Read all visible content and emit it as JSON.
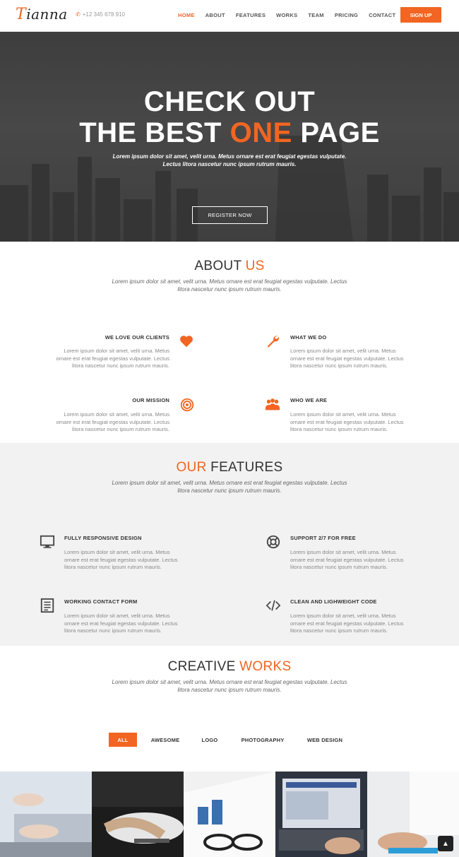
{
  "header": {
    "logo_first": "T",
    "logo_rest": "ianna",
    "phone": "+12 345 678 910",
    "nav": [
      "HOME",
      "ABOUT",
      "FEATURES",
      "WORKS",
      "TEAM",
      "PRICING",
      "CONTACT"
    ],
    "signup_label": "SIGN UP"
  },
  "hero": {
    "line1": "CHECK OUT",
    "line2_a": "THE BEST ",
    "line2_accent": "ONE",
    "line2_b": " PAGE",
    "sub1": "Lorem ipsum dolor sit amet, velit urna. Metus ornare est erat feugiat egestas vulputate.",
    "sub2": "Lectus litora nascetur nunc ipsum rutrum mauris.",
    "register_label": "REGISTER NOW"
  },
  "about": {
    "title_a": "ABOUT ",
    "title_accent": "US",
    "sub1": "Lorem ipsum dolor sit amet, velit urna. Metus ornare est erat feugiat egestas vulputate. Lectus",
    "sub2": "litora nascetur nunc ipsum rutrum mauris.",
    "items": [
      {
        "heading": "WE LOVE OUR CLIENTS",
        "l1": "Lorem ipsum dolor sit amet, velit urna. Metus",
        "l2": "ornare est erat feugiat egestas vulputate. Lectus",
        "l3": "litora nascetur nunc ipsum rutrum mauris.",
        "icon": "heart-icon"
      },
      {
        "heading": "WHAT WE DO",
        "l1": "Lorem ipsum dolor sit amet, velit urna. Metus",
        "l2": "ornare est erat feugiat egestas vulputate. Lectus",
        "l3": "litora nascetur nunc ipsum rutrum mauris.",
        "icon": "wrench-icon"
      },
      {
        "heading": "OUR MISSION",
        "l1": "Lorem ipsum dolor sit amet, velit urna. Metus",
        "l2": "ornare est erat feugiat egestas vulputate. Lectus",
        "l3": "litora nascetur nunc ipsum rutrum mauris.",
        "icon": "target-icon"
      },
      {
        "heading": "WHO WE ARE",
        "l1": "Lorem ipsum dolor sit amet, velit urna. Metus",
        "l2": "ornare est erat feugiat egestas vulputate. Lectus",
        "l3": "litora nascetur nunc ipsum rutrum mauris.",
        "icon": "users-icon"
      }
    ]
  },
  "features": {
    "title_accent": "OUR",
    "title_b": " FEATURES",
    "sub1": "Lorem ipsum dolor sit amet, velit urna. Metus ornare est erat feugiat egestas vulputate. Lectus",
    "sub2": "litora nascetur nunc ipsum rutrum mauris.",
    "items": [
      {
        "heading": "FULLY RESPONSIVE DESIGN",
        "l1": "Lorem ipsum dolor sit amet, velit urna. Metus",
        "l2": "ornare est erat feugiat egestas vulputate. Lectus",
        "l3": "litora nascetur nunc ipsum rutrum mauris.",
        "icon": "monitor-icon"
      },
      {
        "heading": "SUPPORT 2/7 FOR FREE",
        "l1": "Lorem ipsum dolor sit amet, velit urna. Metus",
        "l2": "ornare est erat feugiat egestas vulputate. Lectus",
        "l3": "litora nascetur nunc ipsum rutrum mauris.",
        "icon": "lifebuoy-icon"
      },
      {
        "heading": "WORKING CONTACT FORM",
        "l1": "Lorem ipsum dolor sit amet, velit urna. Metus",
        "l2": "ornare est erat feugiat egestas vulputate. Lectus",
        "l3": "litora nascetur nunc ipsum rutrum mauris.",
        "icon": "form-icon"
      },
      {
        "heading": "CLEAN AND LIGHWEIGHT CODE",
        "l1": "Lorem ipsum dolor sit amet, velit urna. Metus",
        "l2": "ornare est erat feugiat egestas vulputate. Lectus",
        "l3": "litora nascetur nunc ipsum rutrum mauris.",
        "icon": "code-icon"
      }
    ]
  },
  "works": {
    "title_a": "CREATIVE ",
    "title_accent": "WORKS",
    "sub1": "Lorem ipsum dolor sit amet, velit urna. Metus ornare est erat feugiat egestas vulputate. Lectus",
    "sub2": "litora nascetur nunc ipsum rutrum mauris.",
    "filters": [
      "ALL",
      "AWESOME",
      "LOGO",
      "PHOTOGRAPHY",
      "WEB DESIGN"
    ]
  },
  "colors": {
    "accent": "#f26522",
    "dark": "#333333",
    "muted": "#888888",
    "feature_bg": "#f2f2f2"
  }
}
